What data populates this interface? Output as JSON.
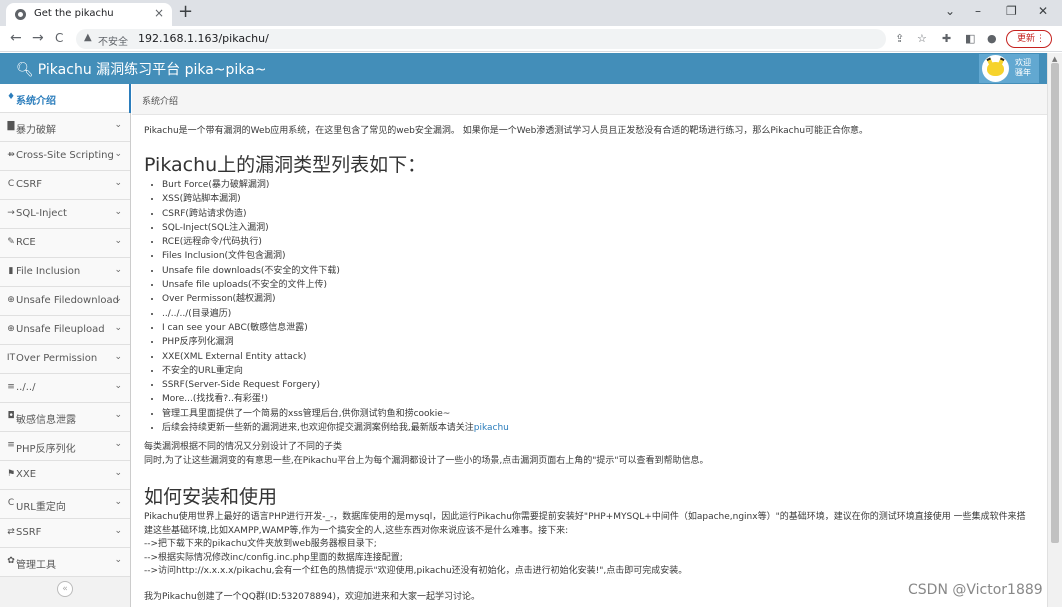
{
  "browser": {
    "tab_title": "Get the pikachu",
    "tab_close": "×",
    "new_tab": "+",
    "win_minimize": "–",
    "win_restore": "❐",
    "win_close": "✕",
    "win_dropdown": "⌄",
    "back": "←",
    "forward": "→",
    "reload": "C",
    "insecure_label": "不安全",
    "url": "192.168.1.163/pikachu/",
    "update_label": "更新",
    "update_menu": "⋮"
  },
  "header": {
    "title": "Pikachu 漏洞练习平台 pika~pika~",
    "welcome_line1": "欢迎",
    "welcome_line2": "骚年"
  },
  "sidebar": {
    "items": [
      {
        "icon": "♦",
        "label": "系统介绍",
        "chev": ""
      },
      {
        "icon": "▇",
        "label": "暴力破解",
        "chev": "⌄"
      },
      {
        "icon": "⇻",
        "label": "Cross-Site Scripting",
        "chev": "⌄"
      },
      {
        "icon": "C",
        "label": "CSRF",
        "chev": "⌄"
      },
      {
        "icon": "→",
        "label": "SQL-Inject",
        "chev": "⌄"
      },
      {
        "icon": "✎",
        "label": "RCE",
        "chev": "⌄"
      },
      {
        "icon": "▮",
        "label": "File Inclusion",
        "chev": "⌄"
      },
      {
        "icon": "⊕",
        "label": "Unsafe Filedownload",
        "chev": "⌄"
      },
      {
        "icon": "⊕",
        "label": "Unsafe Fileupload",
        "chev": "⌄"
      },
      {
        "icon": "IT",
        "label": "Over Permission",
        "chev": "⌄"
      },
      {
        "icon": "≡",
        "label": "../../",
        "chev": "⌄"
      },
      {
        "icon": "◘",
        "label": "敏感信息泄露",
        "chev": "⌄"
      },
      {
        "icon": "≡",
        "label": "PHP反序列化",
        "chev": "⌄"
      },
      {
        "icon": "⚑",
        "label": "XXE",
        "chev": "⌄"
      },
      {
        "icon": "C",
        "label": "URL重定向",
        "chev": "⌄"
      },
      {
        "icon": "⇄",
        "label": "SSRF",
        "chev": "⌄"
      },
      {
        "icon": "✿",
        "label": "管理工具",
        "chev": "⌄"
      }
    ],
    "collapse": "«"
  },
  "breadcrumb": "系统介绍",
  "main": {
    "intro": "Pikachu是一个带有漏洞的Web应用系统，在这里包含了常见的web安全漏洞。 如果你是一个Web渗透测试学习人员且正发愁没有合适的靶场进行练习，那么Pikachu可能正合你意。",
    "types_heading": "Pikachu上的漏洞类型列表如下：",
    "vuln_list": [
      "Burt Force(暴力破解漏洞)",
      "XSS(跨站脚本漏洞)",
      "CSRF(跨站请求伪造)",
      "SQL-Inject(SQL注入漏洞)",
      "RCE(远程命令/代码执行)",
      "Files Inclusion(文件包含漏洞)",
      "Unsafe file downloads(不安全的文件下载)",
      "Unsafe file uploads(不安全的文件上传)",
      "Over Permisson(越权漏洞)",
      "../../../(目录遍历)",
      "I can see your ABC(敏感信息泄露)",
      "PHP反序列化漏洞",
      "XXE(XML External Entity attack)",
      "不安全的URL重定向",
      "SSRF(Server-Side Request Forgery)",
      "More...(找找看?..有彩蛋!)",
      "管理工具里面提供了一个简易的xss管理后台,供你测试钓鱼和捞cookie~"
    ],
    "vuln_last_text": "后续会持续更新一些新的漏洞进来,也欢迎你提交漏洞案例给我,最新版本请关注",
    "vuln_last_link": "pikachu",
    "note_line1": "每类漏洞根据不同的情况又分别设计了不同的子类",
    "note_line2": "同时,为了让这些漏洞变的有意思一些,在Pikachu平台上为每个漏洞都设计了一些小的场景,点击漏洞页面右上角的\"提示\"可以查看到帮助信息。",
    "install_heading": "如何安装和使用",
    "install_lines": [
      "Pikachu使用世界上最好的语言PHP进行开发-_-，数据库使用的是mysql，因此运行Pikachu你需要提前安装好\"PHP+MYSQL+中间件（如apache,nginx等）\"的基础环境，建议在你的测试环境直接使用 一些集成软件来搭建这些基础环境,比如XAMPP,WAMP等,作为一个搞安全的人,这些东西对你来说应该不是什么难事。接下来:",
      "-->把下载下来的pikachu文件夹放到web服务器根目录下;",
      "-->根据实际情况修改inc/config.inc.php里面的数据库连接配置;",
      "-->访问http://x.x.x.x/pikachu,会有一个红色的热情提示\"欢迎使用,pikachu还没有初始化，点击进行初始化安装!\",点击即可完成安装。"
    ],
    "qq_line": "我为Pikachu创建了一个QQ群(ID:532078894)，欢迎加进来和大家一起学习讨论。"
  },
  "watermark": "CSDN @Victor1889",
  "colors": {
    "header": "#438eb9",
    "active_link": "#2b7dbc"
  }
}
